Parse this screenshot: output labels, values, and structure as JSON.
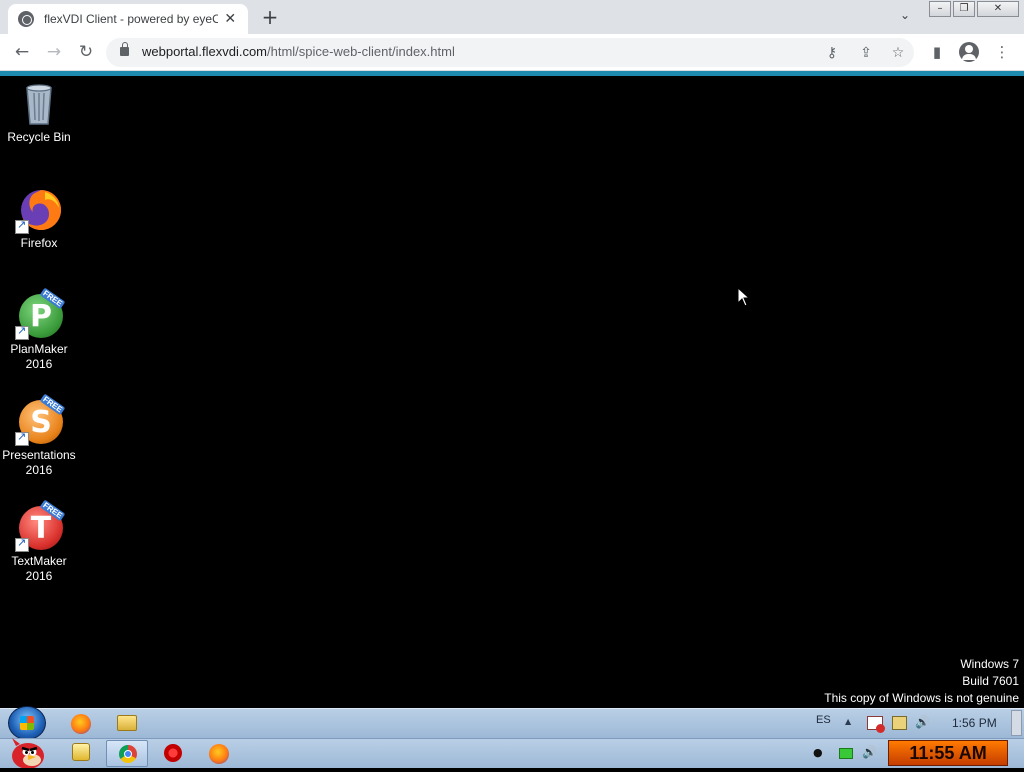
{
  "browser": {
    "tab_title": "flexVDI Client - powered by eyeOS",
    "tab_close": "✕",
    "new_tab": "+",
    "tab_search": "⌄",
    "window_controls": {
      "minimize": "–",
      "restore": "❐",
      "close": "✕"
    },
    "nav": {
      "back": "←",
      "forward": "→",
      "reload": "↻"
    },
    "url_domain": "webportal.flexvdi.com",
    "url_path": "/html/spice-web-client/index.html",
    "omnibox_icons": {
      "key": "⚷",
      "share": "⇪",
      "bookmark": "☆"
    },
    "toolbar_icons": {
      "side_panel": "▮",
      "menu": "⋮"
    },
    "accent_color": "#1e8aad"
  },
  "desktop": {
    "icons": [
      {
        "label": "Recycle Bin",
        "icon": "recycle-bin-icon"
      },
      {
        "label": "Firefox",
        "icon": "firefox-icon"
      },
      {
        "label": "PlanMaker\n2016",
        "icon": "planmaker-icon",
        "letter": "P",
        "color": "#3a9b3a"
      },
      {
        "label": "Presentations\n2016",
        "icon": "presentations-icon",
        "letter": "S",
        "color": "#e8821a"
      },
      {
        "label": "TextMaker\n2016",
        "icon": "textmaker-icon",
        "letter": "T",
        "color": "#d9302c"
      }
    ],
    "free_tag": "FREE",
    "watermark": {
      "line1": "Windows 7",
      "line2": "Build 7601",
      "line3": "This copy of Windows is not genuine"
    }
  },
  "taskbar": {
    "top_row": {
      "language": "ES",
      "tray_arrow": "▲",
      "volume": "🔊",
      "time": "1:56 PM"
    },
    "bottom_row": {
      "volume": "🔊",
      "dot": "●",
      "clock": "11:55 AM"
    }
  }
}
